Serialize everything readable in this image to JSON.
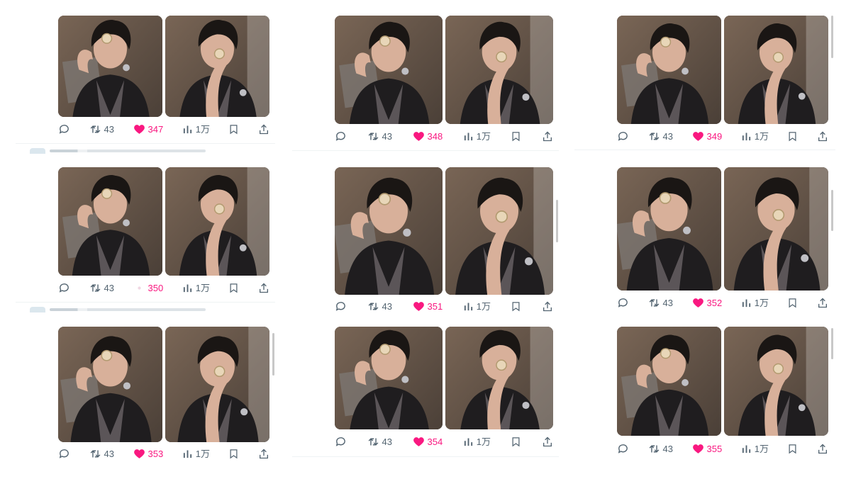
{
  "tweets": [
    {
      "reply_icon": "reply-icon",
      "retweets": "43",
      "likes": "347",
      "views": "1万",
      "liked": true
    },
    {
      "reply_icon": "reply-icon",
      "retweets": "43",
      "likes": "348",
      "views": "1万",
      "liked": true
    },
    {
      "reply_icon": "reply-icon",
      "retweets": "43",
      "likes": "349",
      "views": "1万",
      "liked": true
    },
    {
      "reply_icon": "reply-icon",
      "retweets": "43",
      "likes": "350",
      "views": "1万",
      "liked": false
    },
    {
      "reply_icon": "reply-icon",
      "retweets": "43",
      "likes": "351",
      "views": "1万",
      "liked": true
    },
    {
      "reply_icon": "reply-icon",
      "retweets": "43",
      "likes": "352",
      "views": "1万",
      "liked": true
    },
    {
      "reply_icon": "reply-icon",
      "retweets": "43",
      "likes": "353",
      "views": "1万",
      "liked": true
    },
    {
      "reply_icon": "reply-icon",
      "retweets": "43",
      "likes": "354",
      "views": "1万",
      "liked": true
    },
    {
      "reply_icon": "reply-icon",
      "retweets": "43",
      "likes": "355",
      "views": "1万",
      "liked": true
    }
  ],
  "colors": {
    "like": "#f91880",
    "muted": "#536471",
    "divider": "#eff3f4"
  }
}
